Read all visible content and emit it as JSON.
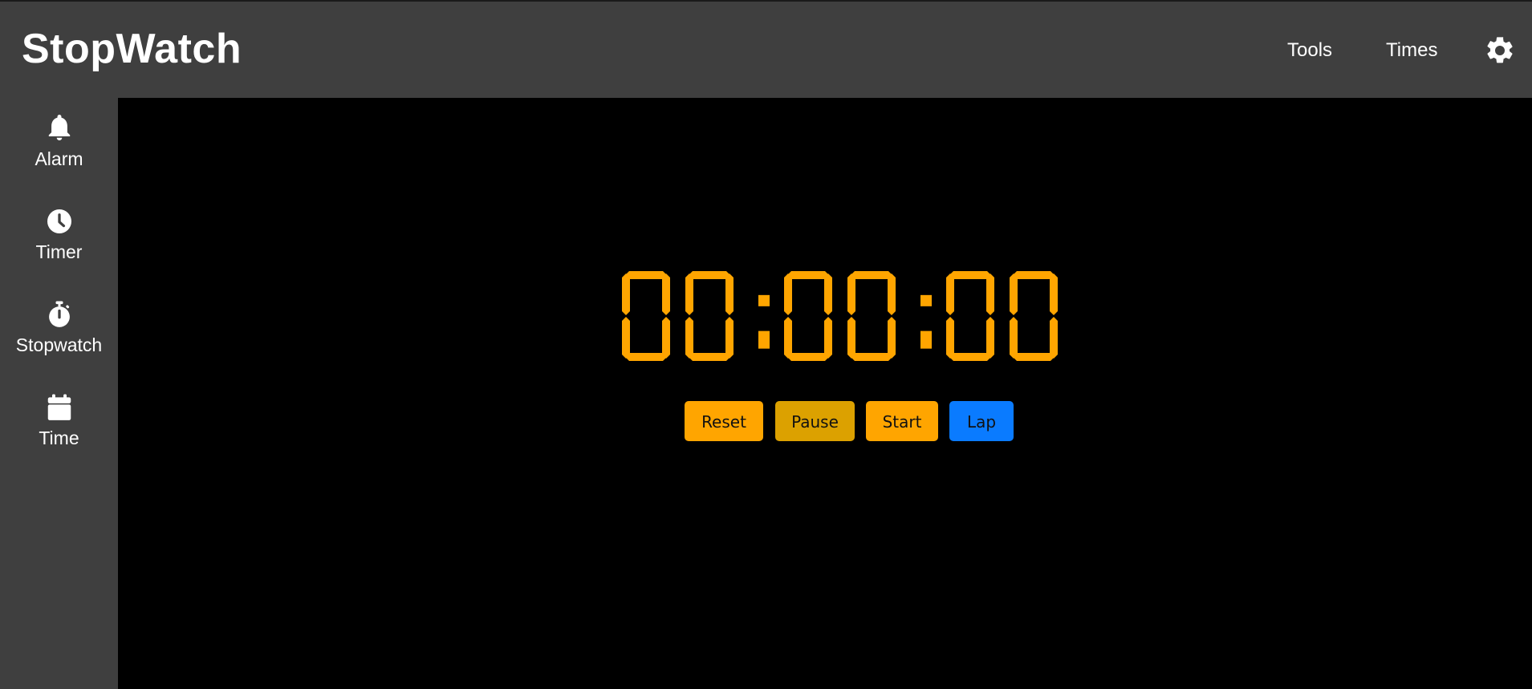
{
  "app": {
    "title": "StopWatch"
  },
  "header": {
    "nav": [
      {
        "label": "Tools"
      },
      {
        "label": "Times"
      }
    ],
    "settings_icon": "gear-icon"
  },
  "sidebar": {
    "items": [
      {
        "label": "Alarm",
        "icon": "bell-icon"
      },
      {
        "label": "Timer",
        "icon": "clock-icon"
      },
      {
        "label": "Stopwatch",
        "icon": "stopwatch-icon"
      },
      {
        "label": "Time",
        "icon": "calendar-icon"
      }
    ]
  },
  "stopwatch": {
    "display": "00:00:00",
    "buttons": {
      "reset": "Reset",
      "pause": "Pause",
      "start": "Start",
      "lap": "Lap"
    }
  },
  "colors": {
    "header_bg": "#3f3f3f",
    "main_bg": "#000000",
    "digits": "#ffa500",
    "reset": "#ffa500",
    "pause": "#dca100",
    "start": "#ffa500",
    "lap": "#0a7bff"
  }
}
